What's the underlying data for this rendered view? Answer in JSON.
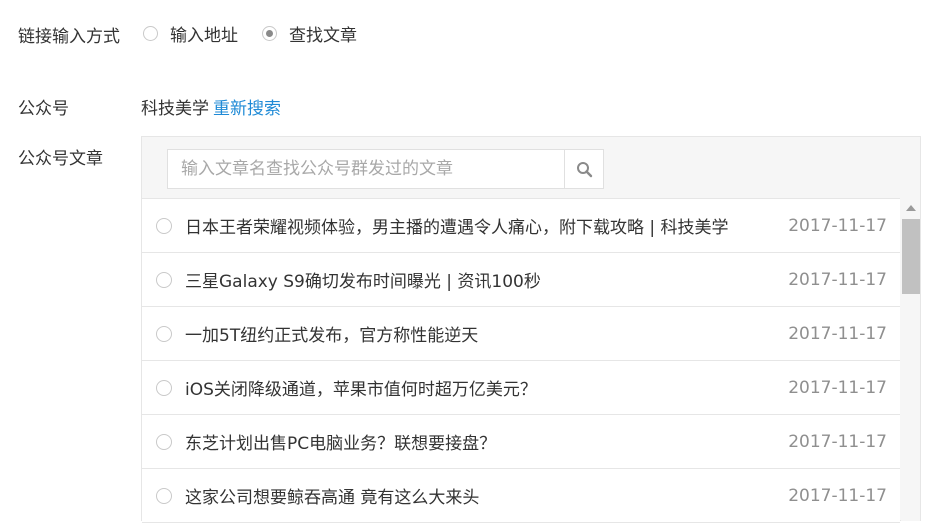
{
  "link_mode": {
    "label": "链接输入方式",
    "options": [
      {
        "label": "输入地址",
        "selected": false
      },
      {
        "label": "查找文章",
        "selected": true
      }
    ]
  },
  "account": {
    "label": "公众号",
    "name": "科技美学",
    "research_link": "重新搜索"
  },
  "articles": {
    "label": "公众号文章",
    "search_placeholder": "输入文章名查找公众号群发过的文章",
    "search_value": "",
    "search_icon": "search-icon",
    "items": [
      {
        "title": "日本王者荣耀视频体验，男主播的遭遇令人痛心，附下载攻略 | 科技美学",
        "date": "2017-11-17"
      },
      {
        "title": "三星Galaxy S9确切发布时间曝光 | 资讯100秒",
        "date": "2017-11-17"
      },
      {
        "title": "一加5T纽约正式发布，官方称性能逆天",
        "date": "2017-11-17"
      },
      {
        "title": "iOS关闭降级通道，苹果市值何时超万亿美元？",
        "date": "2017-11-17"
      },
      {
        "title": "东芝计划出售PC电脑业务？联想要接盘？",
        "date": "2017-11-17"
      },
      {
        "title": "这家公司想要鲸吞高通 竟有这么大来头",
        "date": "2017-11-17"
      }
    ]
  },
  "colors": {
    "link": "#1f8ad6",
    "date": "#8f8f8f",
    "panel_bg": "#f6f6f6"
  }
}
